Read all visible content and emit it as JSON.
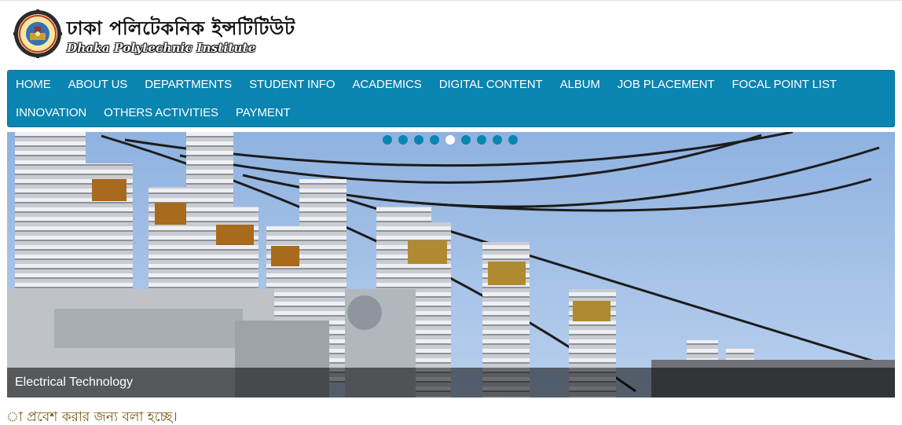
{
  "header": {
    "logo_bn": "ঢাকা পলিটেকনিক ইন্সটিটিউট",
    "logo_en": "Dhaka Polytechnic Institute",
    "emblem_icon": "institute-emblem-icon"
  },
  "nav": {
    "row1": [
      "HOME",
      "ABOUT US",
      "DEPARTMENTS",
      "STUDENT INFO",
      "ACADEMICS",
      "DIGITAL CONTENT",
      "ALBUM",
      "JOB PLACEMENT",
      "FOCAL POINT LIST"
    ],
    "row2": [
      "INNOVATION",
      "OTHERS ACTIVITIES",
      "PAYMENT"
    ],
    "color": "#0a84b0"
  },
  "slider": {
    "caption": "Electrical Technology",
    "slide_count": 9,
    "active_slide": 5
  },
  "marquee": {
    "text": "া প্রবেশ করার জন্য বলা হচ্ছে।"
  }
}
